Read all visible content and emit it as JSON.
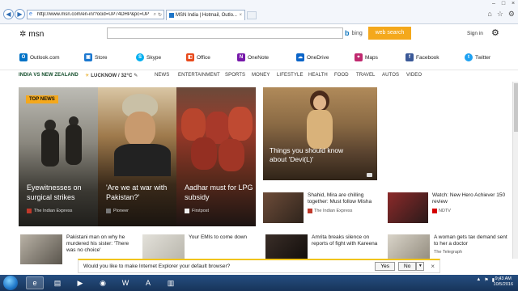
{
  "browser": {
    "url": "http://www.msn.com/en-in/?ocid=UP74DHP&pc=UP",
    "tab_title": "MSN India | Hotmail, Outlo...",
    "tab_close": "×",
    "window_controls": [
      "–",
      "□",
      "×"
    ]
  },
  "header": {
    "logo_text": "msn",
    "search_placeholder": "",
    "bing_label": "bing",
    "web_search_label": "web search",
    "sign_in_label": "Sign in"
  },
  "apps": [
    {
      "label": "Outlook.com",
      "icon": "outlook-icon",
      "color": "#0072c6"
    },
    {
      "label": "Store",
      "icon": "store-icon",
      "color": "#1b78d0"
    },
    {
      "label": "Skype",
      "icon": "skype-icon",
      "color": "#00aff0"
    },
    {
      "label": "Office",
      "icon": "office-icon",
      "color": "#e84a1c"
    },
    {
      "label": "OneNote",
      "icon": "onenote-icon",
      "color": "#7719aa"
    },
    {
      "label": "OneDrive",
      "icon": "onedrive-icon",
      "color": "#0a64c8"
    },
    {
      "label": "Maps",
      "icon": "maps-icon",
      "color": "#c0296f"
    },
    {
      "label": "Facebook",
      "icon": "facebook-icon",
      "color": "#3b5998"
    },
    {
      "label": "Twitter",
      "icon": "twitter-icon",
      "color": "#1da1f2"
    }
  ],
  "nav": {
    "match": "INDIA VS NEW ZEALAND",
    "weather": "LUCKNOW / 32°C",
    "categories": [
      "NEWS",
      "ENTERTAINMENT",
      "SPORTS",
      "MONEY",
      "LIFESTYLE",
      "HEALTH",
      "FOOD",
      "TRAVEL",
      "AUTOS",
      "VIDEO"
    ]
  },
  "tiles": [
    {
      "badge": "TOP NEWS",
      "headline": "Eyewitnesses on surgical strikes",
      "source": "The Indian Express"
    },
    {
      "headline": "'Are we at war with Pakistan?'",
      "source": "Pioneer"
    },
    {
      "headline": "Aadhar must for LPG subsidy",
      "source": "Firstpost"
    },
    {
      "headline": "Things you should know about 'Devi(L)'"
    }
  ],
  "cards": [
    {
      "headline": "Shahid, Mira are chilling together: Must follow Misha",
      "source": "The Indian Express"
    },
    {
      "headline": "Watch: New Hero Achiever 150 review",
      "source": "NDTV"
    }
  ],
  "bottom_row": [
    {
      "headline": "Pakistani man on why he murdered his sister: 'There was no choice'"
    },
    {
      "headline": "Your EMIs to come down"
    },
    {
      "headline": "Amrita breaks silence on reports of fight with Kareena"
    },
    {
      "headline": "A woman gets tax demand sent to her a doctor",
      "source": "The Telegraph"
    }
  ],
  "notification": {
    "message": "Would you like to make Internet Explorer your default browser?",
    "yes": "Yes",
    "no": "No",
    "close": "×"
  },
  "taskbar": {
    "time": "9:43 AM",
    "date": "10/5/2016"
  }
}
